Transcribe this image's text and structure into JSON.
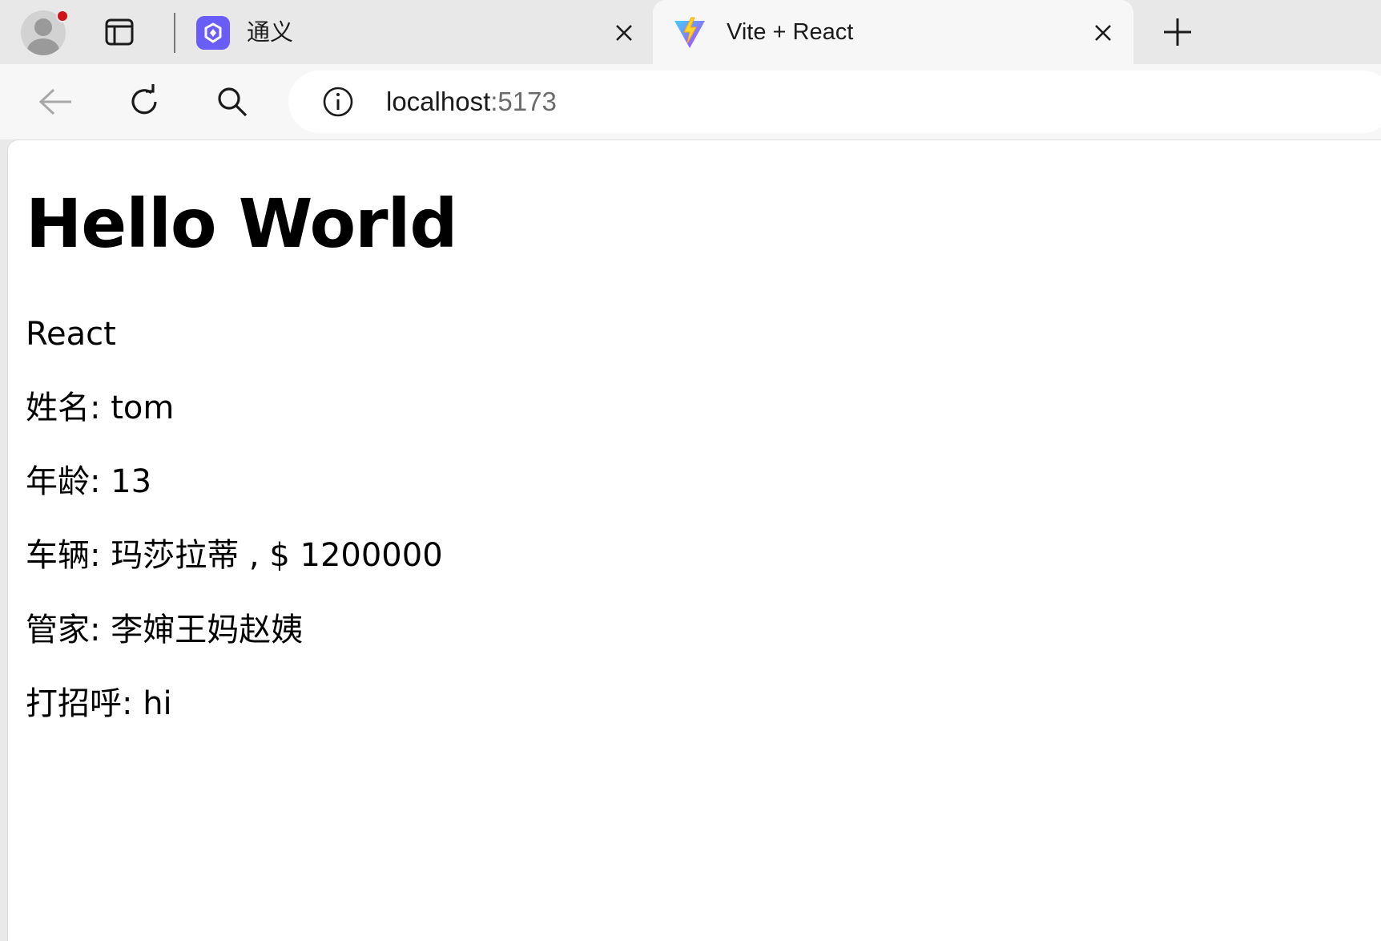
{
  "browser": {
    "tabs": [
      {
        "title": "通义",
        "favicon": "tongyi-logo-icon",
        "active": false
      },
      {
        "title": "Vite + React",
        "favicon": "vite-logo-icon",
        "active": true
      }
    ],
    "address": {
      "host": "localhost",
      "port": ":5173"
    }
  },
  "page": {
    "title": "Hello World",
    "lines": [
      "React",
      "姓名: tom",
      "年龄: 13",
      "车辆: 玛莎拉蒂 , $ 1200000",
      "管家: 李婶王妈赵姨",
      "打招呼: hi"
    ]
  },
  "colors": {
    "tab_strip": "#e8e8e8",
    "active_tab": "#f7f7f7",
    "tongyi_accent": "#6a5cf6",
    "profile_badge": "#d0121b"
  }
}
